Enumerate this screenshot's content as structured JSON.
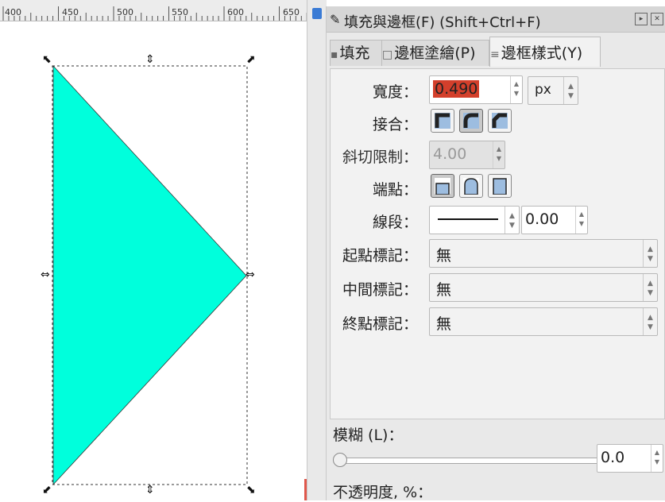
{
  "ruler": {
    "labels": [
      "400",
      "450",
      "500",
      "550",
      "600",
      "650"
    ]
  },
  "colors": {
    "shape_fill": "#00ffdc",
    "accent_red": "#d33f2b",
    "panel_bg": "#e9e9e9"
  },
  "panel": {
    "title": "填充與邊框(F) (Shift+Ctrl+F)",
    "title_icon": "brush-icon",
    "tabs": [
      {
        "label": "填充",
        "icon": "fill-icon"
      },
      {
        "label": "邊框塗繪(P)",
        "icon": "stroke-paint-icon"
      },
      {
        "label": "邊框樣式(Y)",
        "icon": "stroke-style-icon"
      }
    ]
  },
  "stroke_style": {
    "width_label": "寬度：",
    "width_value": "0.490",
    "width_unit": "px",
    "join_label": "接合：",
    "join_buttons": [
      "miter-join-icon",
      "round-join-icon",
      "bevel-join-icon"
    ],
    "miter_label": "斜切限制：",
    "miter_value": "4.00",
    "cap_label": "端點：",
    "cap_buttons": [
      "butt-cap-icon",
      "round-cap-icon",
      "square-cap-icon"
    ],
    "dash_label": "線段：",
    "dash_offset": "0.00",
    "start_marker_label": "起點標記：",
    "start_marker_value": "無",
    "mid_marker_label": "中間標記：",
    "mid_marker_value": "無",
    "end_marker_label": "終點標記：",
    "end_marker_value": "無"
  },
  "blur": {
    "label": "模糊 (L)：",
    "value": "0.0"
  },
  "opacity": {
    "label": "不透明度, %："
  }
}
